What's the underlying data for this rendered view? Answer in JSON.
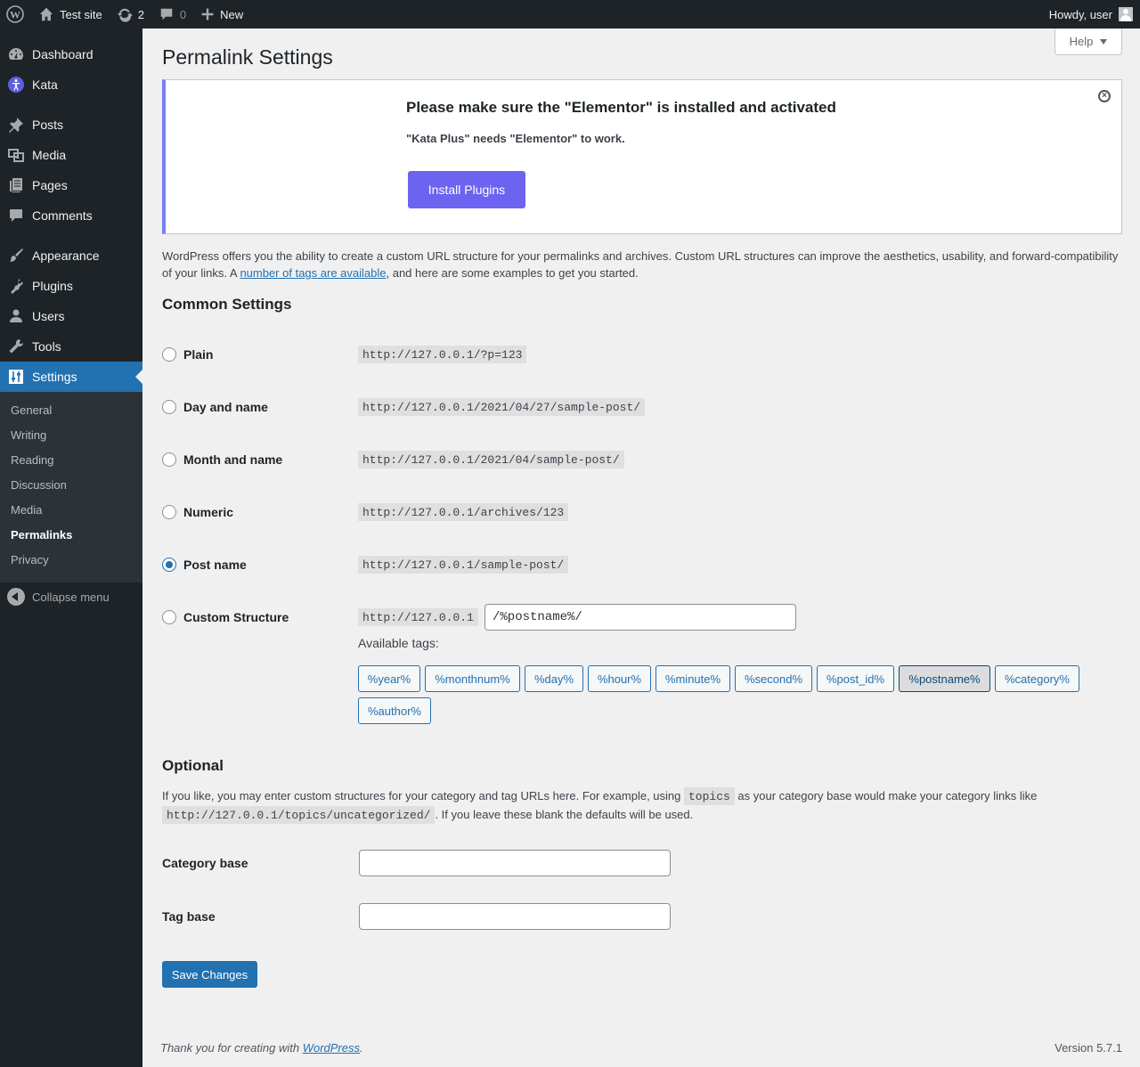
{
  "admin_bar": {
    "site_name": "Test site",
    "updates_count": "2",
    "comments_count": "0",
    "new_label": "New",
    "howdy": "Howdy, user"
  },
  "sidebar": {
    "items": [
      {
        "label": "Dashboard",
        "icon": "dashboard-icon"
      },
      {
        "label": "Kata",
        "icon": "kata-icon"
      },
      {
        "label": "Posts",
        "icon": "pushpin-icon"
      },
      {
        "label": "Media",
        "icon": "media-icon"
      },
      {
        "label": "Pages",
        "icon": "pages-icon"
      },
      {
        "label": "Comments",
        "icon": "comments-icon"
      },
      {
        "label": "Appearance",
        "icon": "paintbrush-icon"
      },
      {
        "label": "Plugins",
        "icon": "plugins-icon"
      },
      {
        "label": "Users",
        "icon": "users-icon"
      },
      {
        "label": "Tools",
        "icon": "wrench-icon"
      },
      {
        "label": "Settings",
        "icon": "settings-icon"
      }
    ],
    "submenu": [
      "General",
      "Writing",
      "Reading",
      "Discussion",
      "Media",
      "Permalinks",
      "Privacy"
    ],
    "collapse_label": "Collapse menu"
  },
  "help_label": "Help",
  "page_title": "Permalink Settings",
  "notice": {
    "heading": "Please make sure the \"Elementor\" is installed and activated",
    "text": "\"Kata Plus\" needs \"Elementor\" to work.",
    "button": "Install Plugins"
  },
  "intro": {
    "before": "WordPress offers you the ability to create a custom URL structure for your permalinks and archives. Custom URL structures can improve the aesthetics, usability, and forward-compatibility of your links. A ",
    "link": "number of tags are available",
    "after": ", and here are some examples to get you started."
  },
  "common_heading": "Common Settings",
  "options": [
    {
      "label": "Plain",
      "url": "http://127.0.0.1/?p=123",
      "checked": false
    },
    {
      "label": "Day and name",
      "url": "http://127.0.0.1/2021/04/27/sample-post/",
      "checked": false
    },
    {
      "label": "Month and name",
      "url": "http://127.0.0.1/2021/04/sample-post/",
      "checked": false
    },
    {
      "label": "Numeric",
      "url": "http://127.0.0.1/archives/123",
      "checked": false
    },
    {
      "label": "Post name",
      "url": "http://127.0.0.1/sample-post/",
      "checked": true
    },
    {
      "label": "Custom Structure",
      "url": "http://127.0.0.1",
      "checked": false
    }
  ],
  "custom_structure_value": "/%postname%/",
  "available_tags_label": "Available tags:",
  "tags": [
    "%year%",
    "%monthnum%",
    "%day%",
    "%hour%",
    "%minute%",
    "%second%",
    "%post_id%",
    "%postname%",
    "%category%",
    "%author%"
  ],
  "active_tag": "%postname%",
  "optional_heading": "Optional",
  "optional_text": {
    "part1": "If you like, you may enter custom structures for your category and tag URLs here. For example, using ",
    "code1": "topics",
    "part2": " as your category base would make your category links like ",
    "code2": "http://127.0.0.1/topics/uncategorized/",
    "part3": ". If you leave these blank the defaults will be used."
  },
  "category_base_label": "Category base",
  "category_base_value": "",
  "tag_base_label": "Tag base",
  "tag_base_value": "",
  "save_label": "Save Changes",
  "footer": {
    "thanks_before": "Thank you for creating with ",
    "thanks_link": "WordPress",
    "thanks_after": ".",
    "version": "Version 5.7.1"
  },
  "colors": {
    "admin_bar": "#1d2327",
    "accent": "#2271b1",
    "notice_accent": "#7a7ff3",
    "install_button": "#6c63f0"
  }
}
